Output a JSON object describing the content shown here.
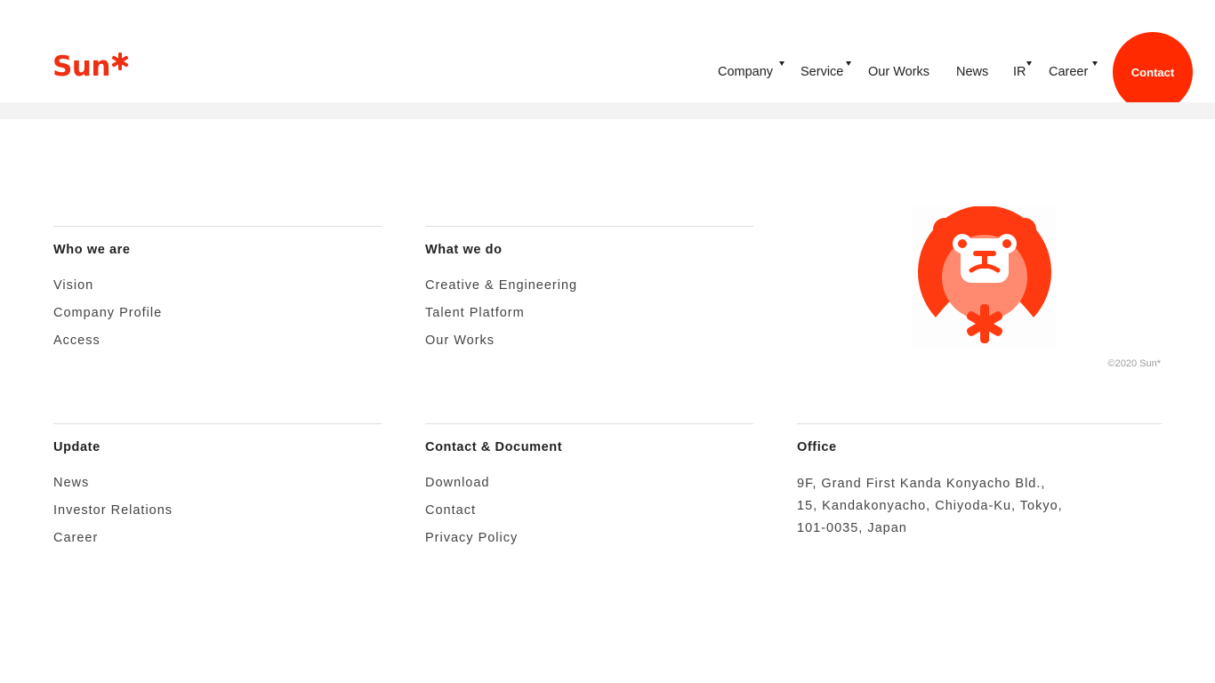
{
  "brand": {
    "logo_text": "Sun",
    "accent_color": "#ff2a00"
  },
  "nav": {
    "items": [
      {
        "label": "Company",
        "has_dropdown": true
      },
      {
        "label": "Service",
        "has_dropdown": true
      },
      {
        "label": "Our Works",
        "has_dropdown": false
      },
      {
        "label": "News",
        "has_dropdown": false
      },
      {
        "label": "IR",
        "has_dropdown": true
      },
      {
        "label": "Career",
        "has_dropdown": true
      }
    ],
    "contact_label": "Contact"
  },
  "footer": {
    "who_we_are": {
      "heading": "Who we are",
      "links": [
        "Vision",
        "Company Profile",
        "Access"
      ]
    },
    "what_we_do": {
      "heading": "What we do",
      "links": [
        "Creative & Engineering",
        "Talent Platform",
        "Our Works"
      ]
    },
    "update": {
      "heading": "Update",
      "links": [
        "News",
        "Investor Relations",
        "Career"
      ]
    },
    "contact_document": {
      "heading": "Contact & Document",
      "links": [
        "Download",
        "Contact",
        "Privacy Policy"
      ]
    },
    "office": {
      "heading": "Office",
      "lines": [
        "9F, Grand First Kanda Konyacho Bld.,",
        "15, Kandakonyacho, Chiyoda-Ku, Tokyo,",
        "101-0035, Japan"
      ]
    },
    "copyright": "©2020 Sun*",
    "mascot_icon": "lion-mascot-icon"
  }
}
